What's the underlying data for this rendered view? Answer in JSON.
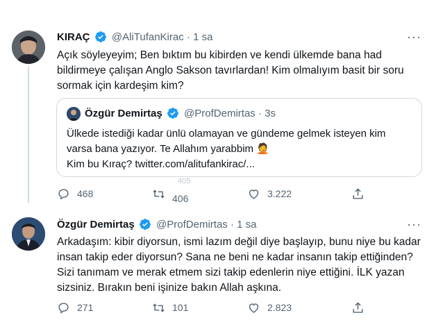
{
  "tweet1": {
    "name": "KIRAÇ",
    "handle": "@AliTufanKirac",
    "dot": "·",
    "time": "1 sa",
    "text": "Açık söyleyeyim; Ben bıktım bu kibirden ve kendi ülkemde bana had\nbildirmeye çalışan Anglo Sakson tavırlardan! Kim olmalıyım basit bir soru\nsormak için kardeşim kim?",
    "quote": {
      "name": "Özgür Demirtaş",
      "handle": "@ProfDemirtas",
      "dot": "·",
      "time": "3s",
      "text": "Ülkede istediği kadar ünlü olamayan ve gündeme gelmek isteyen kim\nvarsa bana yazıyor. Te Allahım yarabbim 🤦\nKim bu Kıraç? twitter.com/alitufankirac/..."
    },
    "replies": "468",
    "retweets": "406",
    "retweets_ghost": "405",
    "likes": "3.222"
  },
  "tweet2": {
    "name": "Özgür Demirtaş",
    "handle": "@ProfDemirtas",
    "dot": "·",
    "time": "1 sa",
    "text": "Arkadaşım: kibir diyorsun, ismi lazım değil diye başlayıp, bunu niye bu kadar\ninsan takip eder diyorsun? Sana ne beni ne kadar insanın takip ettiğinden?\nSizi tanımam ve merak etmem sizi takip edenlerin niye ettiğini. İLK yazan\nsizsiniz. Bırakın beni işinize bakın Allah aşkına.",
    "replies": "271",
    "retweets": "101",
    "likes": "2.823"
  },
  "colors": {
    "accent": "#1d9bf0",
    "muted": "#536471",
    "border": "#cfd9de"
  }
}
